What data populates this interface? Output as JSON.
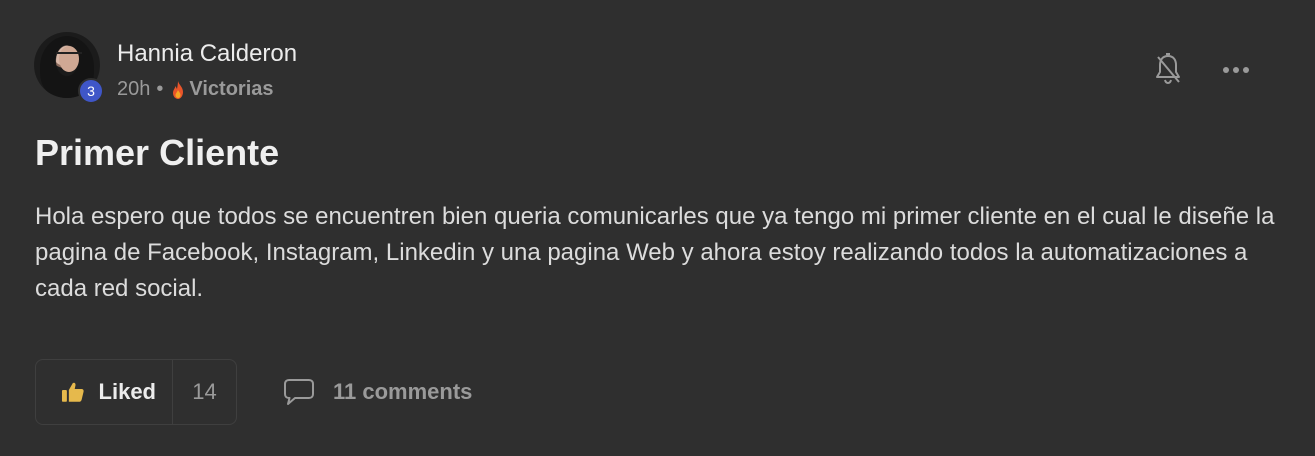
{
  "post": {
    "author": {
      "name": "Hannia Calderon",
      "level": "3",
      "avatar_icon": "user-avatar"
    },
    "meta": {
      "time": "20h",
      "separator": "•",
      "category": "Victorias",
      "category_icon": "fire-icon"
    },
    "actions": {
      "bell_icon": "bell-off-icon",
      "more_icon": "more-horizontal-icon"
    },
    "title": "Primer Cliente",
    "body": "Hola espero que todos se encuentren bien queria comunicarles que ya tengo mi primer cliente en el cual le diseñe la pagina de Facebook, Instagram, Linkedin y una pagina Web y ahora estoy realizando todos la automatizaciones a cada red social.",
    "footer": {
      "like_label": "Liked",
      "like_count": "14",
      "like_icon": "thumbs-up-icon",
      "comments_label": "11 comments",
      "comments_icon": "comment-icon"
    }
  },
  "colors": {
    "background": "#2f2f2f",
    "level_badge": "#3f56c8",
    "liked_accent": "#e6b94c",
    "muted": "#9a9a9a"
  }
}
